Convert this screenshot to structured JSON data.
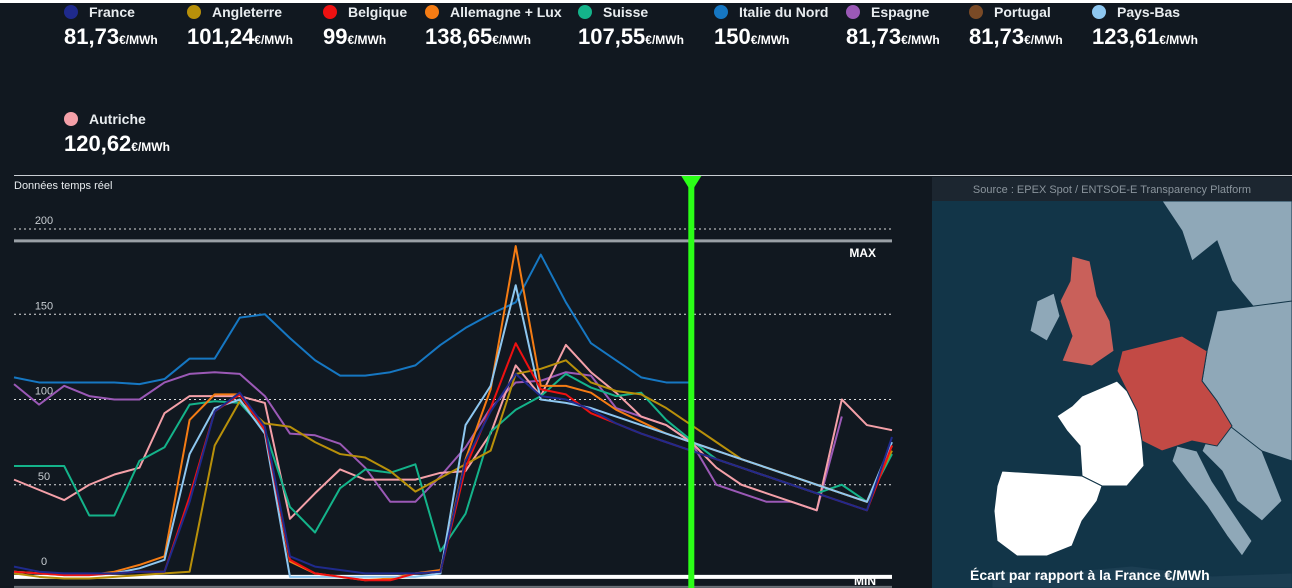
{
  "legend": [
    {
      "name": "France",
      "value": "81,73",
      "unit": "€/MWh",
      "color": "#1f2a8c"
    },
    {
      "name": "Angleterre",
      "value": "101,24",
      "unit": "€/MWh",
      "color": "#b8900a"
    },
    {
      "name": "Belgique",
      "value": "99",
      "unit": "€/MWh",
      "color": "#ee1111"
    },
    {
      "name": "Allemagne + Lux",
      "value": "138,65",
      "unit": "€/MWh",
      "color": "#f57c14"
    },
    {
      "name": "Suisse",
      "value": "107,55",
      "unit": "€/MWh",
      "color": "#14b38a"
    },
    {
      "name": "Italie du Nord",
      "value": "150",
      "unit": "€/MWh",
      "color": "#1677c2"
    },
    {
      "name": "Espagne",
      "value": "81,73",
      "unit": "€/MWh",
      "color": "#9b59b6"
    },
    {
      "name": "Portugal",
      "value": "81,73",
      "unit": "€/MWh",
      "color": "#7a4a26"
    },
    {
      "name": "Pays-Bas",
      "value": "123,61",
      "unit": "€/MWh",
      "color": "#8ec7f0"
    },
    {
      "name": "Autriche",
      "value": "120,62",
      "unit": "€/MWh",
      "color": "#f4a0a8"
    }
  ],
  "chart_label": "Données temps réel",
  "map": {
    "source": "Source : EPEX Spot / ENTSOE-E Transparency Platform",
    "caption": "Écart par rapport à la France €/MWh",
    "colors": {
      "sea": "#123548",
      "neutral": "#8fa8b8",
      "france": "#ffffff",
      "higher": "#c24a45",
      "uk": "#c9605a"
    }
  },
  "chart_data": {
    "type": "line",
    "x": [
      1,
      2,
      3,
      4,
      5,
      6,
      7,
      8,
      9,
      10,
      11,
      12,
      13,
      14,
      15,
      16,
      17,
      18,
      19,
      20,
      21,
      22,
      23,
      24,
      25,
      26,
      27,
      28,
      29,
      30,
      31,
      32,
      33,
      34,
      35,
      36
    ],
    "yticks": [
      0,
      50,
      100,
      150,
      200
    ],
    "ylim": [
      -5,
      205
    ],
    "ref_lines": [
      {
        "label": "MAX",
        "value": 193
      },
      {
        "label": "MIN",
        "value": -4
      }
    ],
    "current_x": 28,
    "series": [
      {
        "name": "Italie du Nord",
        "color": "#1677c2",
        "values": [
          113,
          110,
          110,
          110,
          110,
          109,
          112,
          124,
          124,
          148,
          150,
          136,
          123,
          114,
          114,
          116,
          120,
          132,
          142,
          150,
          157,
          185,
          157,
          133,
          123,
          113,
          110,
          110
        ]
      },
      {
        "name": "Espagne",
        "color": "#9b59b6",
        "values": [
          109,
          97,
          108,
          102,
          100,
          100,
          110,
          115,
          116,
          115,
          102,
          80,
          79,
          74,
          60,
          40,
          40,
          55,
          72,
          95,
          110,
          111,
          116,
          114,
          95,
          90,
          85,
          75,
          50,
          45,
          40,
          40,
          35,
          90
        ]
      },
      {
        "name": "Autriche",
        "color": "#f4a0a8",
        "values": [
          53,
          47,
          41,
          50,
          56,
          60,
          92,
          102,
          102,
          102,
          98,
          30,
          45,
          59,
          53,
          53,
          53,
          57,
          58,
          80,
          120,
          102,
          132,
          116,
          104,
          90,
          85,
          75,
          60,
          50,
          45,
          40,
          35,
          100,
          85,
          82
        ]
      },
      {
        "name": "Suisse",
        "color": "#14b38a",
        "values": [
          61,
          61,
          61,
          32,
          32,
          64,
          72,
          97,
          99,
          98,
          82,
          37,
          22,
          48,
          59,
          57,
          62,
          11,
          33,
          81,
          94,
          102,
          115,
          107,
          102,
          104,
          88,
          76,
          65,
          60,
          55,
          50,
          45,
          50,
          40,
          68
        ]
      },
      {
        "name": "Angleterre",
        "color": "#b8900a",
        "values": [
          -2,
          -4,
          -5,
          -5,
          -4,
          -3,
          -2,
          -1,
          73,
          99,
          86,
          84,
          75,
          68,
          66,
          58,
          46,
          54,
          62,
          70,
          115,
          118,
          123,
          110,
          105,
          103,
          95,
          85,
          75,
          65,
          60,
          55,
          50,
          45,
          40,
          70
        ]
      },
      {
        "name": "Allemagne + Lux",
        "color": "#f57c14",
        "values": [
          -1,
          -2,
          -3,
          -3,
          -1,
          3,
          8,
          88,
          103,
          103,
          83,
          5,
          -2,
          -4,
          -6,
          -5,
          -2,
          0,
          65,
          106,
          190,
          108,
          108,
          104,
          94,
          87,
          80,
          75,
          70,
          65,
          60,
          55,
          50,
          45,
          40,
          73
        ]
      },
      {
        "name": "Pays-Bas",
        "color": "#8ec7f0",
        "values": [
          -1,
          -2,
          -3,
          -3,
          -2,
          1,
          6,
          68,
          95,
          100,
          80,
          -4,
          -4,
          -4,
          -4,
          -4,
          -4,
          -2,
          85,
          108,
          167,
          100,
          98,
          95,
          90,
          85,
          80,
          75,
          70,
          65,
          60,
          55,
          50,
          45,
          40,
          75
        ]
      },
      {
        "name": "Belgique",
        "color": "#ee1111",
        "values": [
          -1,
          -2,
          -3,
          -3,
          -2,
          -1,
          -1,
          43,
          93,
          103,
          82,
          6,
          -2,
          -4,
          -6,
          -6,
          -2,
          -1,
          60,
          95,
          133,
          106,
          103,
          92,
          86,
          80,
          75,
          70,
          65,
          60,
          55,
          50,
          45,
          40,
          35,
          73
        ]
      },
      {
        "name": "France",
        "color": "#1f2a8c",
        "values": [
          2,
          -1,
          -2,
          -2,
          -2,
          -1,
          -1,
          40,
          93,
          104,
          84,
          8,
          2,
          0,
          -2,
          -2,
          -2,
          -1,
          64,
          93,
          115,
          102,
          100,
          94,
          86,
          80,
          75,
          70,
          65,
          60,
          55,
          50,
          45,
          40,
          35,
          78
        ]
      }
    ]
  }
}
